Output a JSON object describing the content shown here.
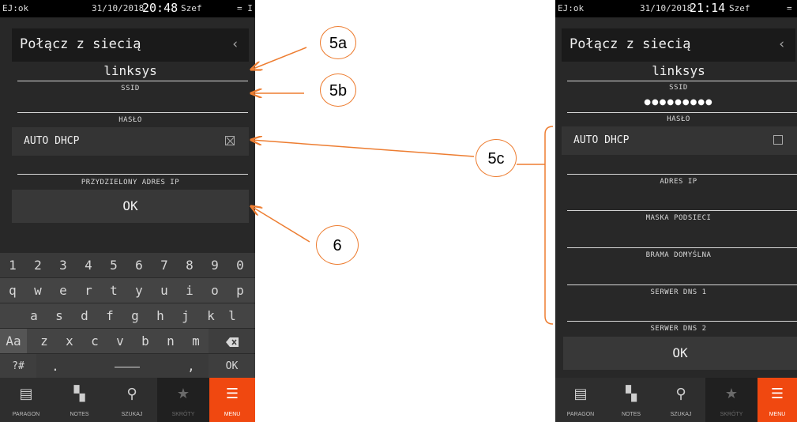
{
  "left": {
    "status": {
      "ej": "EJ:ok",
      "date": "31/10/2018",
      "time": "20:48",
      "user": "Szef",
      "icons": "= I"
    },
    "title": "Połącz z siecią",
    "back_icon": "chevron-left-icon",
    "ssid_value": "linksys",
    "ssid_label": "SSID",
    "password_label": "HASŁO",
    "dhcp_label": "AUTO DHCP",
    "dhcp_checked": true,
    "ip_label": "PRZYDZIELONY ADRES IP",
    "ok_label": "OK",
    "keyboard": {
      "row1": [
        "1",
        "2",
        "3",
        "4",
        "5",
        "6",
        "7",
        "8",
        "9",
        "0"
      ],
      "row2": [
        "q",
        "w",
        "e",
        "r",
        "t",
        "y",
        "u",
        "i",
        "o",
        "p"
      ],
      "row3": [
        "a",
        "s",
        "d",
        "f",
        "g",
        "h",
        "j",
        "k",
        "l"
      ],
      "row4": [
        "Aa",
        "z",
        "x",
        "c",
        "v",
        "b",
        "n",
        "m"
      ],
      "symbols": "?#",
      "dot": ".",
      "comma": ",",
      "ok": "OK"
    }
  },
  "right": {
    "status": {
      "ej": "EJ:ok",
      "date": "31/10/2018",
      "time": "21:14",
      "user": "Szef",
      "icons": "="
    },
    "title": "Połącz z siecią",
    "back_icon": "chevron-left-icon",
    "ssid_value": "linksys",
    "ssid_label": "SSID",
    "password_dots": "●●●●●●●●●",
    "password_label": "HASŁO",
    "dhcp_label": "AUTO DHCP",
    "dhcp_checked": false,
    "fields": [
      "ADRES IP",
      "MASKA PODSIECI",
      "BRAMA DOMYŚLNA",
      "SERWER DNS 1",
      "SERWER DNS 2"
    ],
    "ok_label": "OK"
  },
  "nav": [
    {
      "label": "PARAGON",
      "icon": "receipt-icon"
    },
    {
      "label": "NOTES",
      "icon": "book-icon"
    },
    {
      "label": "SZUKAJ",
      "icon": "search-icon"
    },
    {
      "label": "SKRÓTY",
      "icon": "star-icon"
    },
    {
      "label": "MENU",
      "icon": "menu-icon"
    }
  ],
  "annotations": {
    "a": "5a",
    "b": "5b",
    "c": "5c",
    "d": "6"
  },
  "colors": {
    "accent": "#f04810",
    "annotation": "#ed7d31",
    "background": "#282828"
  }
}
